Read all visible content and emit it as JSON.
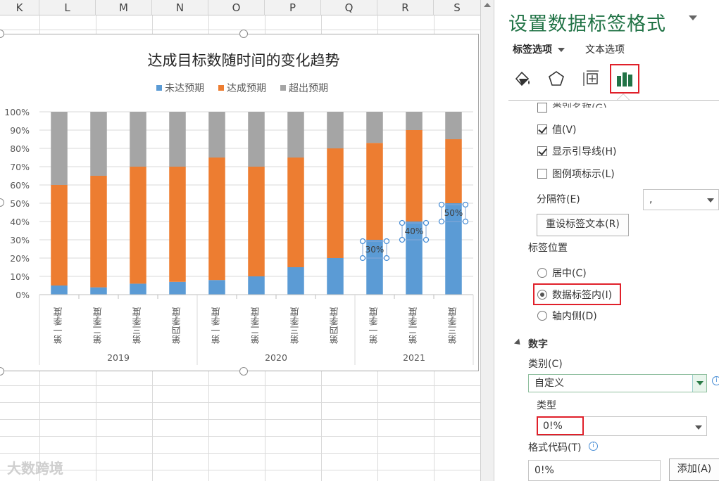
{
  "sheet": {
    "columns": [
      "K",
      "L",
      "M",
      "N",
      "O",
      "P",
      "Q",
      "R",
      "S"
    ]
  },
  "chart": {
    "watermark": "大数跨境"
  },
  "chart_data": {
    "type": "bar",
    "stacked": true,
    "title": "达成目标数随时间的变化趋势",
    "categories": [
      "第一季度",
      "第二季度",
      "第三季度",
      "第四季度",
      "第一季度",
      "第二季度",
      "第三季度",
      "第四季度",
      "第一季度",
      "第二季度",
      "第三季度"
    ],
    "groups": [
      {
        "label": "2019",
        "count": 4
      },
      {
        "label": "2020",
        "count": 4
      },
      {
        "label": "2021",
        "count": 3
      }
    ],
    "series": [
      {
        "name": "未达预期",
        "color": "#5b9bd5",
        "values": [
          5,
          4,
          6,
          7,
          8,
          10,
          15,
          20,
          30,
          40,
          50
        ]
      },
      {
        "name": "达成预期",
        "color": "#ed7d31",
        "values": [
          55,
          61,
          64,
          63,
          67,
          60,
          60,
          60,
          53,
          50,
          35
        ]
      },
      {
        "name": "超出预期",
        "color": "#a5a5a5",
        "values": [
          40,
          35,
          30,
          30,
          25,
          30,
          25,
          20,
          17,
          10,
          15
        ]
      }
    ],
    "ylim": [
      0,
      100
    ],
    "yticks": [
      "0%",
      "10%",
      "20%",
      "30%",
      "40%",
      "50%",
      "60%",
      "70%",
      "80%",
      "90%",
      "100%"
    ],
    "data_labels": [
      {
        "category_index": 8,
        "text": "30%"
      },
      {
        "category_index": 9,
        "text": "40%"
      },
      {
        "category_index": 10,
        "text": "50%"
      }
    ],
    "legend_position": "top",
    "grid": true
  },
  "pane": {
    "title": "设置数据标签格式",
    "tab_label_options": "标签选项",
    "tab_text_options": "文本选项",
    "icons": [
      "fill-line-icon",
      "effects-icon",
      "size-properties-icon",
      "label-options-icon"
    ],
    "partial_row": "类别名称(G)",
    "check_value": "值(V)",
    "check_leader": "显示引导线(H)",
    "check_legend": "图例项标示(L)",
    "separator_label": "分隔符(E)",
    "separator_value": ",",
    "reset_button": "重设标签文本(R)",
    "position_label": "标签位置",
    "pos_center": "居中(C)",
    "pos_inside_end": "数据标签内(I)",
    "pos_inside_base": "轴内侧(D)",
    "number_section": "数字",
    "category_label": "类别(C)",
    "category_value": "自定义",
    "type_label": "类型",
    "type_value": "0!%",
    "format_code_label": "格式代码(T)",
    "format_code_value": "0!%",
    "add_button": "添加(A)",
    "info_glyph": "i"
  }
}
